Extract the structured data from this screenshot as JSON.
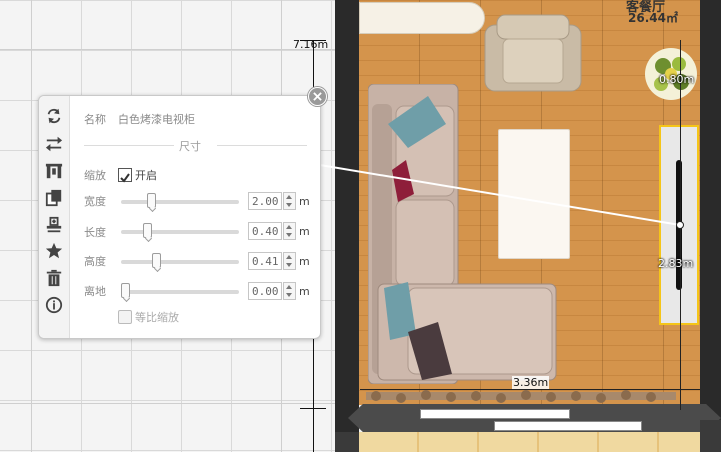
{
  "floorplan": {
    "room_name": "客餐厅",
    "room_area": "26.44㎡",
    "dim_height": "7.16m",
    "dim_plant": "0.80m",
    "dim_measure": "2.83m",
    "dim_bottom": "3.36m"
  },
  "panel": {
    "name_label": "名称",
    "name_value": "白色烤漆电视柜",
    "section_title": "尺寸",
    "scale_label": "缩放",
    "scale_option": "开启",
    "scale_checked": true,
    "rows": [
      {
        "label": "宽度",
        "value": "2.00",
        "unit": "m",
        "slider_fraction": 0.24
      },
      {
        "label": "长度",
        "value": "0.40",
        "unit": "m",
        "slider_fraction": 0.2
      },
      {
        "label": "高度",
        "value": "0.41",
        "unit": "m",
        "slider_fraction": 0.28
      },
      {
        "label": "离地",
        "value": "0.00",
        "unit": "m",
        "slider_fraction": 0.0
      }
    ],
    "proportional_label": "等比缩放",
    "proportional_checked": false
  },
  "toolbar": {
    "icons": [
      "rotate-icon",
      "flip-icon",
      "align-icon",
      "copy-icon",
      "stamp-icon",
      "star-icon",
      "delete-icon",
      "info-icon"
    ]
  },
  "colors": {
    "floor": "#d08e45",
    "wall": "#2a2a2a",
    "selection": "#f5c518",
    "grid": "#d9d9d9"
  }
}
